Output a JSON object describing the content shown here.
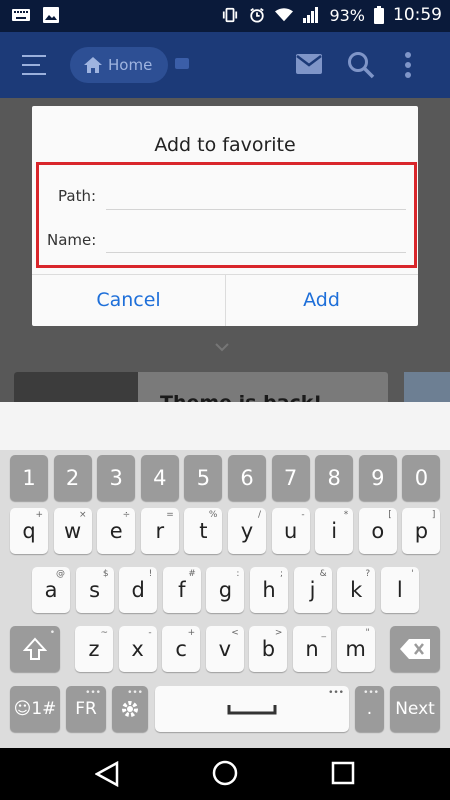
{
  "status_bar": {
    "battery": "93%",
    "time": "10:59"
  },
  "app_bar": {
    "home_label": "Home"
  },
  "background_card": {
    "title": "Theme is back!"
  },
  "dialog": {
    "title": "Add to favorite",
    "path_label": "Path:",
    "path_value": "",
    "name_label": "Name:",
    "name_value": "",
    "cancel_label": "Cancel",
    "add_label": "Add"
  },
  "keyboard": {
    "number_row": [
      "1",
      "2",
      "3",
      "4",
      "5",
      "6",
      "7",
      "8",
      "9",
      "0"
    ],
    "row1": [
      {
        "k": "q",
        "h": "+"
      },
      {
        "k": "w",
        "h": "×"
      },
      {
        "k": "e",
        "h": "÷"
      },
      {
        "k": "r",
        "h": "="
      },
      {
        "k": "t",
        "h": "%"
      },
      {
        "k": "y",
        "h": "/"
      },
      {
        "k": "u",
        "h": "-"
      },
      {
        "k": "i",
        "h": "*"
      },
      {
        "k": "o",
        "h": "["
      },
      {
        "k": "p",
        "h": "]"
      }
    ],
    "row2": [
      {
        "k": "a",
        "h": "@"
      },
      {
        "k": "s",
        "h": "$"
      },
      {
        "k": "d",
        "h": "!"
      },
      {
        "k": "f",
        "h": "#"
      },
      {
        "k": "g",
        "h": ":"
      },
      {
        "k": "h",
        "h": ";"
      },
      {
        "k": "j",
        "h": "&"
      },
      {
        "k": "k",
        "h": "?"
      },
      {
        "k": "l",
        "h": "'"
      }
    ],
    "row3": [
      {
        "k": "z",
        "h": "~"
      },
      {
        "k": "x",
        "h": "-"
      },
      {
        "k": "c",
        "h": "+"
      },
      {
        "k": "v",
        "h": "<"
      },
      {
        "k": "b",
        "h": ">"
      },
      {
        "k": "n",
        "h": "_"
      },
      {
        "k": "m",
        "h": "\""
      }
    ],
    "emoji_label": "☺1#",
    "lang_label": "FR",
    "period_label": ".",
    "next_label": "Next"
  },
  "colors": {
    "accent": "#1e6fd9",
    "highlight_border": "#d9262b",
    "app_bar": "#1c3a78"
  }
}
